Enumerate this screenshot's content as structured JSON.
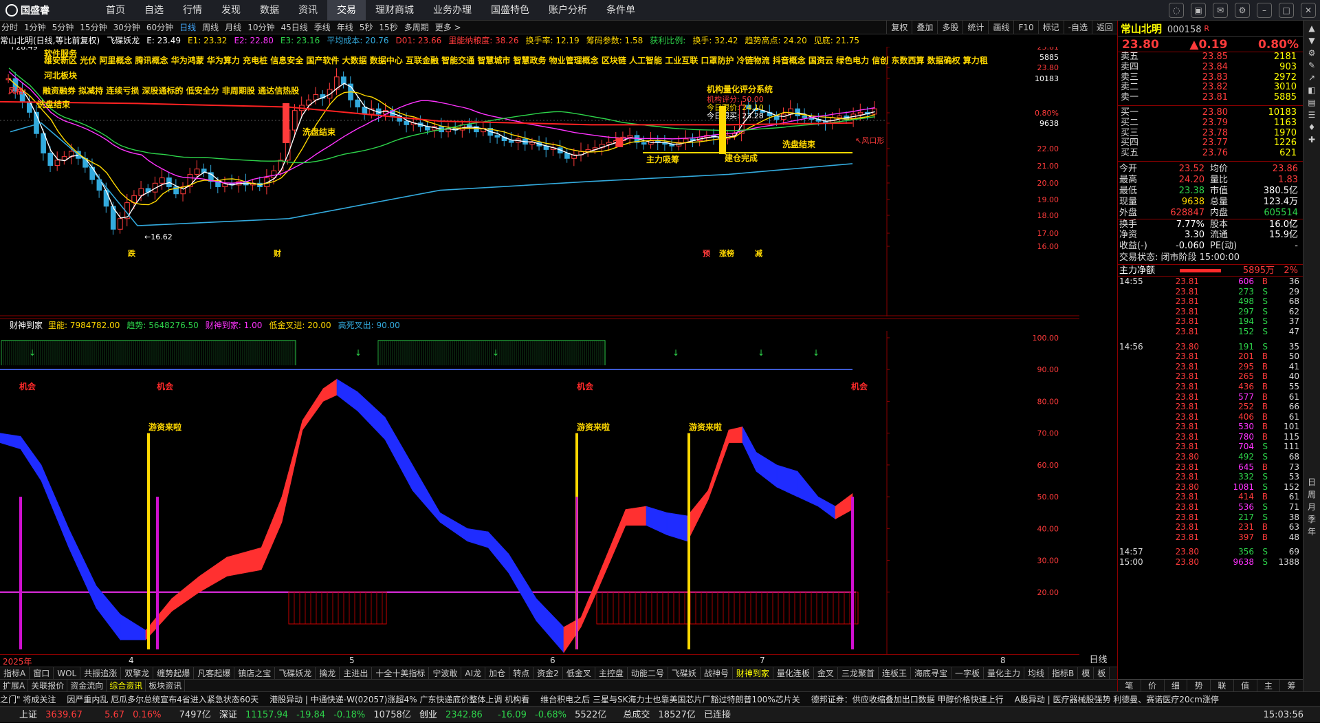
{
  "app": {
    "logo": "国盛睿"
  },
  "menu": [
    "首页",
    "自选",
    "行情",
    "发现",
    "数据",
    "资讯",
    "交易",
    "理财商城",
    "业务办理",
    "国盛特色",
    "账户分析",
    "条件单"
  ],
  "menu_active": "交易",
  "periods": [
    "分时",
    "1分钟",
    "5分钟",
    "15分钟",
    "30分钟",
    "60分钟",
    "日线",
    "周线",
    "月线",
    "10分钟",
    "45日线",
    "季线",
    "年线",
    "5秒",
    "15秒",
    "多周期",
    "更多 >"
  ],
  "period_active": "日线",
  "tools": [
    "复权",
    "叠加",
    "多股",
    "统计",
    "画线",
    "F10",
    "标记",
    "-自选",
    "返回"
  ],
  "info": [
    {
      "t": "常山北明(日线,等比前复权)",
      "c": "white"
    },
    {
      "t": "飞碟妖龙",
      "c": "white"
    },
    {
      "t": "E: 23.49",
      "c": "white"
    },
    {
      "t": "E1: 23.32",
      "c": "yellow"
    },
    {
      "t": "E2: 22.80",
      "c": "mag"
    },
    {
      "t": "E3: 23.16",
      "c": "green"
    },
    {
      "t": "平均成本: 20.76",
      "c": "cyan"
    },
    {
      "t": "D01: 23.66",
      "c": "red"
    },
    {
      "t": "里能纳粮度: 38.26",
      "c": "red"
    },
    {
      "t": "换手率: 12.19",
      "c": "yellow"
    },
    {
      "t": "筹码参数: 1.58",
      "c": "yellow"
    },
    {
      "t": "获利比例:",
      "c": "green"
    },
    {
      "t": "换手: 32.42",
      "c": "yellow"
    },
    {
      "t": "趋势高点: 24.20",
      "c": "yellow"
    },
    {
      "t": "见底: 21.75",
      "c": "yellow"
    }
  ],
  "concepts": "雄安新区 光伏 阿里概念 腾讯概念 华为鸿蒙 华为算力 充电桩 信息安全 国产软件 大数据 数据中心 互联金融 智能交通 智慧城市 智慧政务 物业管理概念 区块链 人工智能 工业互联 口罩防护 冷链物流 抖音概念 国资云 绿色电力 信创 东数西算 数据确权 算力租",
  "labels": {
    "software": "软件服务",
    "region": "河北板块",
    "risk": "风格:",
    "traits": "融资融券 拟减持 连续亏损 深股通标的 低安全分 非周期股 通达信热股",
    "high": "28.49",
    "low": "16.62",
    "wash1": "洗盘结束",
    "wash2": "洗盘结束",
    "wash3": "洗盘结束",
    "main": "主力吸筹",
    "build": "建仓完成",
    "windrisk": "风口形",
    "system_title": "机构量化评分系统",
    "score": "机构评分: 50.00",
    "today_open": "今日限价: 24.10",
    "today_buy": "今日限买: 23.28",
    "bottom_drop": "跌",
    "bottom_cai": "财",
    "flag1": "预",
    "flag2": "涨榜",
    "flag3": "减"
  },
  "main_axis": [
    "23.81",
    "5885",
    "23.80",
    "10183",
    "22.00",
    "21.00",
    "20.00",
    "19.00",
    "18.00",
    "17.00",
    "16.00",
    "0.80%",
    "9638"
  ],
  "main_axis_ticks": [
    {
      "v": "23.81"
    },
    {
      "v": "5885"
    },
    {
      "v": "23.80"
    },
    {
      "v": "10183"
    },
    {
      "v": "0.80%"
    },
    {
      "v": "9638"
    },
    {
      "v": "22.00"
    },
    {
      "v": "21.00"
    },
    {
      "v": "20.00"
    },
    {
      "v": "19.00"
    },
    {
      "v": "18.00"
    },
    {
      "v": "17.00"
    },
    {
      "v": "16.00"
    }
  ],
  "sub": {
    "name": "财神到家",
    "items": [
      {
        "t": "里能: 7984782.00",
        "c": "yellow"
      },
      {
        "t": "趋势: 5648276.50",
        "c": "green"
      },
      {
        "t": "财神到家: 1.00",
        "c": "mag"
      },
      {
        "t": "低金叉进: 20.00",
        "c": "yellow"
      },
      {
        "t": "高死叉出: 90.00",
        "c": "cyan"
      }
    ],
    "chance": "机会",
    "youzi": "游资来啦"
  },
  "sub_axis": [
    "100.00",
    "90.00",
    "80.00",
    "70.00",
    "60.00",
    "50.00",
    "40.00",
    "30.00",
    "20.00"
  ],
  "dates": [
    "2025年",
    "4",
    "5",
    "6",
    "7",
    "8"
  ],
  "ytag": "日线",
  "tabs1": [
    "指标A",
    "窗口",
    "WOL",
    "共振追涨",
    "双擎龙",
    "缠势起爆",
    "凡客起爆",
    "镇店之宝",
    "飞碟妖龙",
    "擒龙",
    "主进出",
    "十全十美指标",
    "宁波敢",
    "AI龙",
    "加仓",
    "转点",
    "资金2",
    "低金叉",
    "主控盘",
    "动能二号",
    "飞碟妖",
    "战神号",
    "财神到家",
    "量化连板",
    "金叉",
    "三龙聚首",
    "连板王",
    "海底寻宝",
    "一字板",
    "量化主力",
    "均线",
    "指标B",
    "模",
    "板"
  ],
  "tabs1_active": "财神到家",
  "tabs2": [
    "扩展A",
    "关联报价",
    "资金流向",
    "综合资讯",
    "板块资讯"
  ],
  "tabs2_active": "综合资讯",
  "news": [
    "之门\" 将成关注",
    "因严重内乱 厄瓜多尔总统宣布4省进入紧急状态60天",
    "港股异动 | 中通快递-W(02057)涨超4% 广东快递底价整体上调 机构看",
    "维台积电之后 三星与SK海力士也靠美国芯片厂豁过特朗普100%芯片关",
    "德邦证券：供应收缩叠加出口数据 甲醇价格快速上行",
    "A股异动 | 医疗器械股强势 利德曼、赛诺医疗20cm涨停"
  ],
  "status": {
    "sh_label": "上证",
    "sh": "3639.67",
    "sh_ch": "5.67",
    "sh_pct": "0.16%",
    "sh_amt": "7497亿",
    "sz_label": "深证",
    "sz": "11157.94",
    "sz_ch": "-19.84",
    "sz_pct": "-0.18%",
    "sz_amt": "10758亿",
    "cy_label": "创业",
    "cy": "2342.86",
    "cy_ch": "-16.09",
    "cy_pct": "-0.68%",
    "cy_amt": "5522亿",
    "total_label": "总成交",
    "total": "18527亿",
    "conn": "已连接",
    "time": "15:03:56"
  },
  "quote": {
    "name": "常山北明",
    "code": "000158",
    "flag": "R",
    "price": "23.80",
    "change": "▲0.19",
    "pct": "0.80%"
  },
  "asks": [
    {
      "l": "卖五",
      "p": "23.85",
      "v": "2181"
    },
    {
      "l": "卖四",
      "p": "23.84",
      "v": "903"
    },
    {
      "l": "卖三",
      "p": "23.83",
      "v": "2972"
    },
    {
      "l": "卖二",
      "p": "23.82",
      "v": "3010"
    },
    {
      "l": "卖一",
      "p": "23.81",
      "v": "5885"
    }
  ],
  "bids": [
    {
      "l": "买一",
      "p": "23.80",
      "v": "10183"
    },
    {
      "l": "买二",
      "p": "23.79",
      "v": "1163"
    },
    {
      "l": "买三",
      "p": "23.78",
      "v": "1970"
    },
    {
      "l": "买四",
      "p": "23.77",
      "v": "1226"
    },
    {
      "l": "买五",
      "p": "23.76",
      "v": "621"
    }
  ],
  "stats": [
    {
      "l1": "今开",
      "v1": "23.52",
      "c1": "red",
      "l2": "均价",
      "v2": "23.86",
      "c2": "red"
    },
    {
      "l1": "最高",
      "v1": "24.20",
      "c1": "red",
      "l2": "量比",
      "v2": "1.83",
      "c2": "red"
    },
    {
      "l1": "最低",
      "v1": "23.38",
      "c1": "green",
      "l2": "市值",
      "v2": "380.5亿",
      "c2": "white"
    },
    {
      "l1": "现量",
      "v1": "9638",
      "c1": "yellow",
      "l2": "总量",
      "v2": "123.4万",
      "c2": "white"
    },
    {
      "l1": "外盘",
      "v1": "628847",
      "c1": "red",
      "l2": "内盘",
      "v2": "605514",
      "c2": "green"
    },
    {
      "l1": "换手",
      "v1": "7.77%",
      "c1": "white",
      "l2": "股本",
      "v2": "16.0亿",
      "c2": "white"
    },
    {
      "l1": "净资",
      "v1": "3.30",
      "c1": "white",
      "l2": "流通",
      "v2": "15.9亿",
      "c2": "white"
    },
    {
      "l1": "收益(-)",
      "v1": "-0.060",
      "c1": "white",
      "l2": "PE(动)",
      "v2": "-",
      "c2": "white"
    }
  ],
  "tradestate": "交易状态: 闭市阶段 15:00:00",
  "netflow": {
    "label": "主力净额",
    "value": "5895万",
    "pct": "2%"
  },
  "ticks": [
    {
      "t": "14:55",
      "p": "23.81",
      "v": "606",
      "s": "B",
      "n": "36"
    },
    {
      "t": "",
      "p": "23.81",
      "v": "273",
      "s": "S",
      "n": "29"
    },
    {
      "t": "",
      "p": "23.81",
      "v": "498",
      "s": "S",
      "n": "68"
    },
    {
      "t": "",
      "p": "23.81",
      "v": "297",
      "s": "S",
      "n": "62"
    },
    {
      "t": "",
      "p": "23.81",
      "v": "194",
      "s": "S",
      "n": "37"
    },
    {
      "t": "",
      "p": "23.81",
      "v": "152",
      "s": "S",
      "n": "47"
    },
    {
      "t": "14:56",
      "p": "23.80",
      "v": "191",
      "s": "S",
      "n": "35"
    },
    {
      "t": "",
      "p": "23.81",
      "v": "201",
      "s": "B",
      "n": "50"
    },
    {
      "t": "",
      "p": "23.81",
      "v": "295",
      "s": "B",
      "n": "41"
    },
    {
      "t": "",
      "p": "23.81",
      "v": "265",
      "s": "B",
      "n": "40"
    },
    {
      "t": "",
      "p": "23.81",
      "v": "436",
      "s": "B",
      "n": "55"
    },
    {
      "t": "",
      "p": "23.81",
      "v": "577",
      "s": "B",
      "n": "61"
    },
    {
      "t": "",
      "p": "23.81",
      "v": "252",
      "s": "B",
      "n": "66"
    },
    {
      "t": "",
      "p": "23.81",
      "v": "406",
      "s": "B",
      "n": "61"
    },
    {
      "t": "",
      "p": "23.81",
      "v": "530",
      "s": "B",
      "n": "101"
    },
    {
      "t": "",
      "p": "23.81",
      "v": "780",
      "s": "B",
      "n": "115"
    },
    {
      "t": "",
      "p": "23.81",
      "v": "704",
      "s": "S",
      "n": "111"
    },
    {
      "t": "",
      "p": "23.80",
      "v": "492",
      "s": "S",
      "n": "68"
    },
    {
      "t": "",
      "p": "23.81",
      "v": "645",
      "s": "B",
      "n": "73"
    },
    {
      "t": "",
      "p": "23.81",
      "v": "332",
      "s": "S",
      "n": "53"
    },
    {
      "t": "",
      "p": "23.80",
      "v": "1081",
      "s": "S",
      "n": "152"
    },
    {
      "t": "",
      "p": "23.81",
      "v": "414",
      "s": "B",
      "n": "61"
    },
    {
      "t": "",
      "p": "23.81",
      "v": "536",
      "s": "S",
      "n": "71"
    },
    {
      "t": "",
      "p": "23.81",
      "v": "217",
      "s": "S",
      "n": "38"
    },
    {
      "t": "",
      "p": "23.81",
      "v": "231",
      "s": "B",
      "n": "63"
    },
    {
      "t": "",
      "p": "23.81",
      "v": "397",
      "s": "B",
      "n": "48"
    },
    {
      "t": "14:57",
      "p": "23.80",
      "v": "356",
      "s": "S",
      "n": "69"
    },
    {
      "t": "15:00",
      "p": "23.80",
      "v": "9638",
      "s": "S",
      "n": "1388"
    }
  ],
  "rtabs": [
    "笔",
    "价",
    "细",
    "势",
    "联",
    "值",
    "主",
    "筹"
  ],
  "sidebar": [
    "日",
    "周",
    "月",
    "季",
    "年"
  ]
}
